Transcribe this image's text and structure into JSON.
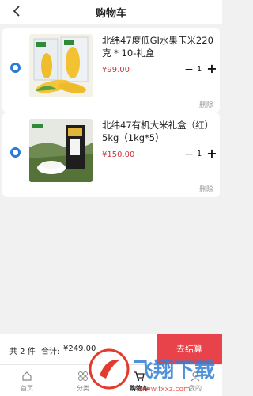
{
  "header": {
    "back_icon": "back-chevron-icon",
    "title": "购物车"
  },
  "cart": {
    "items": [
      {
        "name": "北纬47度低GI水果玉米220克 * 10-礼盒",
        "price": "¥99.00",
        "quantity": "1",
        "minus": "−",
        "plus": "+",
        "delete": "删除",
        "selected": true,
        "image": "corn-gift-box-image"
      },
      {
        "name": "北纬47有机大米礼盒（红）5kg（1kg*5）",
        "price": "¥150.00",
        "quantity": "1",
        "minus": "−",
        "plus": "+",
        "delete": "删除",
        "selected": true,
        "image": "rice-gift-box-image"
      }
    ]
  },
  "summary": {
    "count": "共 2 件",
    "total_label": "合计:",
    "total_value": "¥249.00",
    "checkout": "去结算"
  },
  "tabbar": {
    "tabs": [
      {
        "label": "首页",
        "icon": "home-icon",
        "active": false
      },
      {
        "label": "分类",
        "icon": "category-icon",
        "active": false
      },
      {
        "label": "购物车",
        "icon": "cart-icon",
        "active": true
      },
      {
        "label": "我的",
        "icon": "profile-icon",
        "active": false
      }
    ]
  },
  "watermark": {
    "text": "飞翔下载",
    "url": "www.fxxz.com"
  },
  "colors": {
    "accent": "#2b7ad8",
    "price": "#c9353a",
    "checkout": "#e8434a",
    "background": "#f1f1f1"
  }
}
